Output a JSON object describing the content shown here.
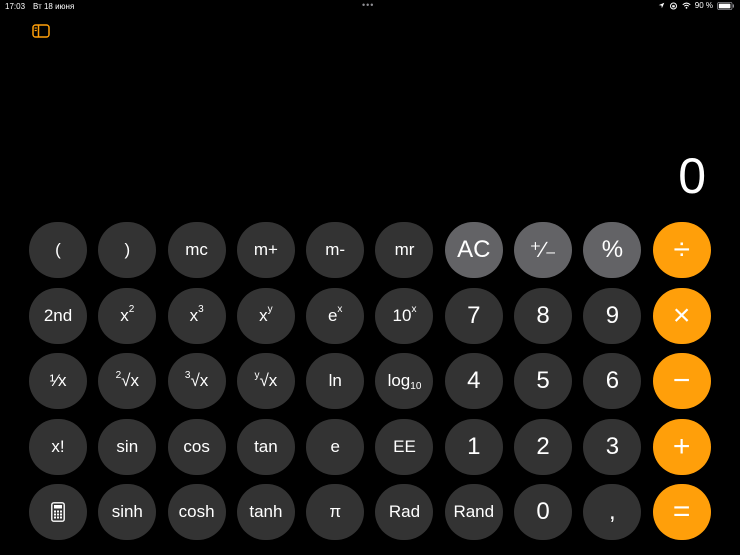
{
  "status": {
    "time": "17:03",
    "date": "Вт 18 июня",
    "dots": "•••",
    "battery": "90 %"
  },
  "display": {
    "value": "0"
  },
  "keys": {
    "open_paren": "(",
    "close_paren": ")",
    "mc": "mc",
    "mplus": "m+",
    "mminus": "m-",
    "mr": "mr",
    "ac": "AC",
    "plus_minus": "⁺∕₋",
    "percent": "%",
    "divide": "÷",
    "second": "2nd",
    "x2_base": "x",
    "x2_sup": "2",
    "x3_base": "x",
    "x3_sup": "3",
    "xy_base": "x",
    "xy_sup": "y",
    "ex_base": "e",
    "ex_sup": "x",
    "tenx_base": "10",
    "tenx_sup": "x",
    "seven": "7",
    "eight": "8",
    "nine": "9",
    "multiply": "×",
    "reciprocal": "¹⁄x",
    "sqrt2_index": "2",
    "sqrt2_root": "√x",
    "sqrt3_index": "3",
    "sqrt3_root": "√x",
    "sqrty_index": "y",
    "sqrty_root": "√x",
    "ln": "ln",
    "log_base": "log",
    "log_sub": "10",
    "four": "4",
    "five": "5",
    "six": "6",
    "minus": "−",
    "factorial": "x!",
    "sin": "sin",
    "cos": "cos",
    "tan": "tan",
    "e": "e",
    "ee": "EE",
    "one": "1",
    "two": "2",
    "three": "3",
    "plus": "+",
    "sinh": "sinh",
    "cosh": "cosh",
    "tanh": "tanh",
    "pi": "π",
    "rad": "Rad",
    "rand": "Rand",
    "zero": "0",
    "decimal": ",",
    "equals": "="
  },
  "colors": {
    "background": "#000000",
    "key_dark": "#333333",
    "key_gray": "#636366",
    "key_orange": "#ff9f0a",
    "sidebar_icon": "#ff9f0a"
  }
}
